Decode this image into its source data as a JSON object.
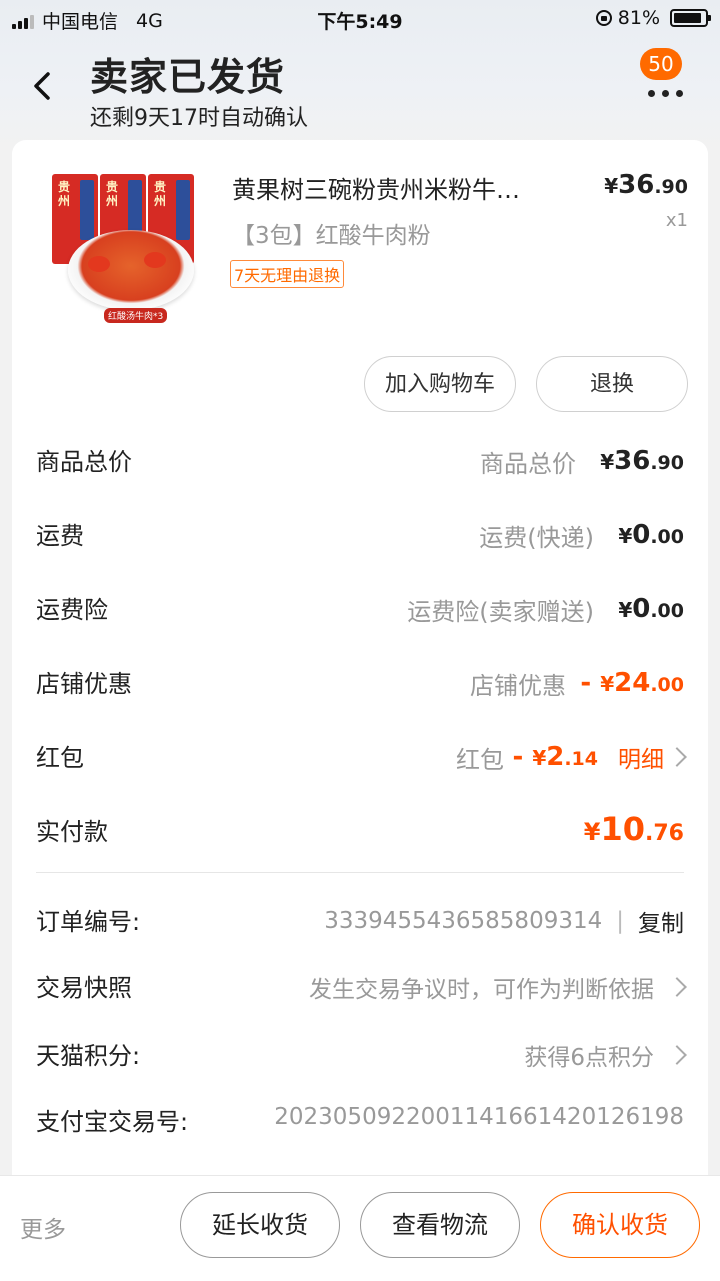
{
  "status_bar": {
    "carrier": "中国电信",
    "network": "4G",
    "time": "下午5:49",
    "battery": "81%"
  },
  "header": {
    "title": "卖家已发货",
    "subtitle": "还剩9天17时自动确认",
    "badge_count": "50"
  },
  "product": {
    "name": "黄果树三碗粉贵州米粉牛…",
    "spec": "【3包】红酸牛肉粉",
    "tag": "7天无理由退换",
    "price_int": "36",
    "price_dec": ".90",
    "qty": "x1",
    "image_caption": "红酸汤牛肉*3",
    "package_text": "贵州"
  },
  "actions": {
    "add_to_cart": "加入购物车",
    "return": "退换"
  },
  "summary": [
    {
      "label": "商品总价",
      "desc": "商品总价",
      "sign": "",
      "yen": "¥",
      "int": "36",
      "dec": ".90"
    },
    {
      "label": "运费",
      "desc": "运费(快递)",
      "sign": "",
      "yen": "¥",
      "int": "0",
      "dec": ".00"
    },
    {
      "label": "运费险",
      "desc": "运费险(卖家赠送)",
      "sign": "",
      "yen": "¥",
      "int": "0",
      "dec": ".00"
    },
    {
      "label": "店铺优惠",
      "desc": "店铺优惠",
      "sign": "-",
      "yen": "¥",
      "int": "24",
      "dec": ".00"
    },
    {
      "label": "红包",
      "desc": "红包",
      "sign": "-",
      "yen": "¥",
      "int": "2",
      "dec": ".14",
      "link": "明细"
    },
    {
      "label": "实付款",
      "yen": "¥",
      "int": "10",
      "dec": ".76"
    }
  ],
  "info": {
    "order_no_label": "订单编号:",
    "order_no": "3339455436585809314",
    "copy": "复制",
    "snapshot_label": "交易快照",
    "snapshot_value": "发生交易争议时，可作为判断依据",
    "points_label": "天猫积分:",
    "points_value": "获得6点积分",
    "alipay_label": "支付宝交易号:",
    "alipay_value": "2023050922001141661420126198"
  },
  "bottom": {
    "more": "更多",
    "extend": "延长收货",
    "track": "查看物流",
    "confirm": "确认收货"
  },
  "colors": {
    "accent": "#ff5000",
    "badge": "#ff6a00"
  }
}
